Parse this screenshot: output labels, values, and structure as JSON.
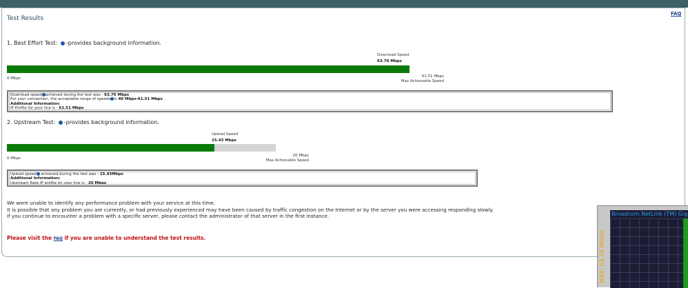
{
  "header": {
    "title": "Test Results",
    "faq_link": "FAQ"
  },
  "best_effort": {
    "heading_prefix": "1. Best Effort Test:",
    "heading_suffix": "-provides background information.",
    "bar": {
      "caption": "Download Speed",
      "value_text": "63.76 Mbps",
      "min_label": "0 Mbps",
      "max_value_text": "61.51 Mbps",
      "max_label": "Max Achievable Speed",
      "fill_fraction": 1.0
    },
    "info": {
      "line1_pre": "Download speed",
      "line1_mid": "achieved during the test was - ",
      "line1_val": "63.76 Mbps",
      "line2_pre": "For your connection, the acceptable range of speeds",
      "line2_mid": "is ",
      "line2_val": "40 Mbps-61.51 Mbps",
      "line2_post": ".",
      "line3": "Additional Information:",
      "line4_pre": "IP Profile for your line is - ",
      "line4_val": "61.51 Mbps"
    }
  },
  "upstream": {
    "heading_prefix": "2. Upstream Test:",
    "heading_suffix": "-provides background information.",
    "bar": {
      "caption": "Upload Speed",
      "value_text": "15.43 Mbps",
      "min_label": "0 Mbps",
      "max_value_text": "20 Mbps",
      "max_label": "Max Achievable Speed",
      "fill_fraction": 0.7715
    },
    "info": {
      "line1_pre": "Upload speed",
      "line1_mid": " achieved during the test was - ",
      "line1_val": "15.43Mbps",
      "line2": "Additional Information:",
      "line3_pre": "Upstream Rate IP profile on your line is - ",
      "line3_val": "20 Mbps"
    }
  },
  "message": {
    "line1": "We were unable to identify any performance problem with your service at this time.",
    "line2": "It is possible that any problem you are currently, or had previously experienced may have been caused by traffic congestion on the Internet or by the server you were accessing responding slowly.",
    "line3": "If you continue to encounter a problem with a specific server, please contact the administrator of that server in the first instance."
  },
  "visit": {
    "pre": "Please visit the ",
    "link": "FAQ",
    "post": " if you are unable to understand the test results."
  },
  "net_widget": {
    "header": "Broadcom NetLink (TM) Gigabit",
    "max_label": "MAX: 63.78 Mbit/s"
  },
  "colors": {
    "bar_fill": "#0b7a0b",
    "bar_track": "#d4d4d4",
    "alert_text": "#c01010"
  }
}
